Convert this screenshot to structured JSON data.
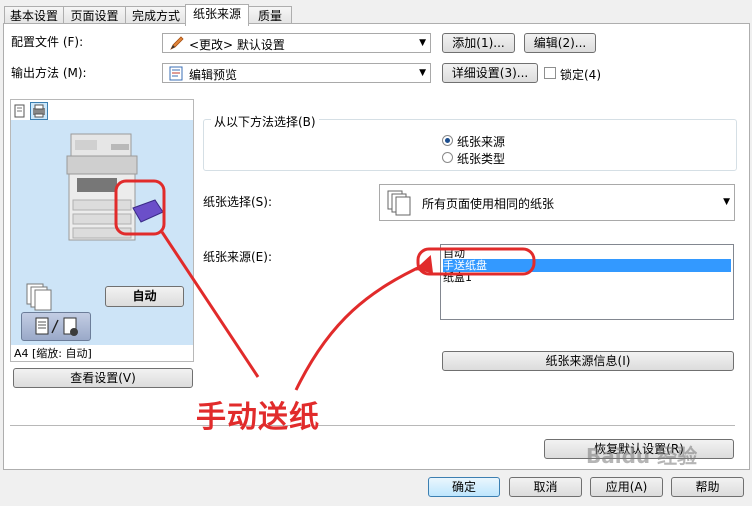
{
  "tabs": [
    "基本设置",
    "页面设置",
    "完成方式",
    "纸张来源",
    "质量"
  ],
  "config_file": {
    "label": "配置文件 (F):",
    "value": "<更改> 默认设置",
    "add_button": "添加(1)...",
    "edit_button": "编辑(2)..."
  },
  "output_method": {
    "label": "输出方法 (M):",
    "value": "编辑预览",
    "details_button": "详细设置(3)...",
    "lock_label": "锁定(4)"
  },
  "preview": {
    "auto_button": "自动",
    "status": "A4 [缩放: 自动]",
    "view_settings_button": "查看设置(V)"
  },
  "select_method": {
    "title": "从以下方法选择(B)",
    "options": [
      "纸张来源",
      "纸张类型"
    ],
    "selected_index": 0
  },
  "paper_selection": {
    "label": "纸张选择(S):",
    "value": "所有页面使用相同的纸张"
  },
  "paper_source": {
    "label": "纸张来源(E):",
    "items": [
      "自动",
      "手送纸盘",
      "纸盒1"
    ],
    "selected_index": 1,
    "info_button": "纸张来源信息(I)"
  },
  "restore_button": "恢复默认设置(R)",
  "dialog_buttons": {
    "ok": "确定",
    "cancel": "取消",
    "apply": "应用(A)",
    "help": "帮助"
  },
  "annotation": {
    "text": "手动送纸",
    "color": "#e12b2b"
  },
  "watermark": "Baidu 经验",
  "colors": {
    "selection": "#3399ff",
    "preview_bg": "#cde4f7",
    "annotation": "#e12b2b"
  }
}
